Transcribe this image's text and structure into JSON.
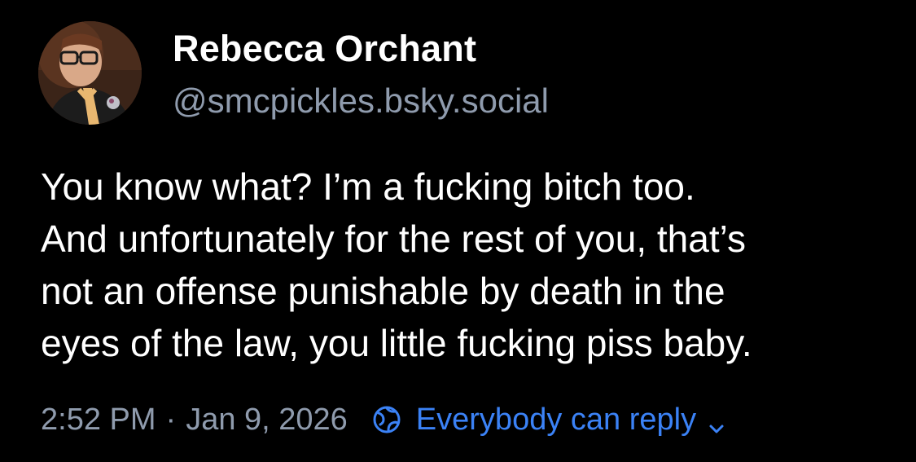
{
  "author": {
    "name": "Rebecca Orchant",
    "handle": "@smcpickles.bsky.social",
    "avatar_icon": "profile-photo"
  },
  "post": {
    "lines": [
      "You know what? I’m a fucking bitch too.",
      "And unfortunately for the rest of you, that’s",
      "not an offense punishable by death in the",
      "eyes of the law, you little fucking piss baby."
    ]
  },
  "meta": {
    "time": "2:52 PM",
    "separator": "·",
    "date": "Jan 9, 2026",
    "reply_setting_label": "Everybody can reply",
    "reply_icon": "globe-icon",
    "dropdown_icon": "chevron-down-icon"
  },
  "colors": {
    "background": "#000000",
    "text": "#ffffff",
    "muted": "#8f9bad",
    "accent": "#3b82f6"
  }
}
